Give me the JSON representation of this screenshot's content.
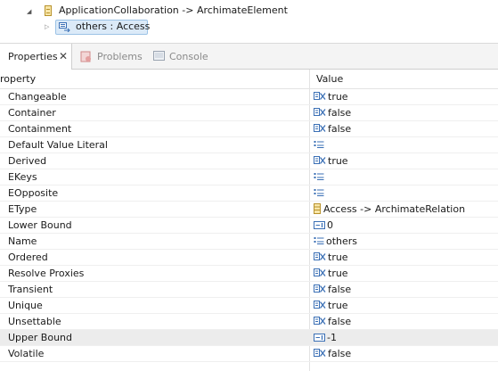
{
  "tree": {
    "parent_label": "ApplicationCollaboration -> ArchimateElement",
    "child_label": "others : Access"
  },
  "tabs": [
    {
      "label": "Properties",
      "icon": "properties-icon",
      "active": true
    },
    {
      "label": "Problems",
      "icon": "problems-icon",
      "active": false
    },
    {
      "label": "Console",
      "icon": "console-icon",
      "active": false
    }
  ],
  "table": {
    "headers": {
      "property": "roperty",
      "value": "Value"
    },
    "rows": [
      {
        "property": "Changeable",
        "value": "true",
        "icon": "boolean-icon"
      },
      {
        "property": "Container",
        "value": "false",
        "icon": "boolean-icon"
      },
      {
        "property": "Containment",
        "value": "false",
        "icon": "boolean-icon"
      },
      {
        "property": "Default Value Literal",
        "value": "",
        "icon": "text-icon"
      },
      {
        "property": "Derived",
        "value": "true",
        "icon": "boolean-icon"
      },
      {
        "property": "EKeys",
        "value": "",
        "icon": "text-icon"
      },
      {
        "property": "EOpposite",
        "value": "",
        "icon": "text-icon"
      },
      {
        "property": "EType",
        "value": "Access -> ArchimateRelation",
        "icon": "class-icon"
      },
      {
        "property": "Lower Bound",
        "value": "0",
        "icon": "number-icon"
      },
      {
        "property": "Name",
        "value": "others",
        "icon": "text-icon"
      },
      {
        "property": "Ordered",
        "value": "true",
        "icon": "boolean-icon"
      },
      {
        "property": "Resolve Proxies",
        "value": "true",
        "icon": "boolean-icon"
      },
      {
        "property": "Transient",
        "value": "false",
        "icon": "boolean-icon"
      },
      {
        "property": "Unique",
        "value": "true",
        "icon": "boolean-icon"
      },
      {
        "property": "Unsettable",
        "value": "false",
        "icon": "boolean-icon"
      },
      {
        "property": "Upper Bound",
        "value": "-1",
        "icon": "number-icon",
        "highlighted": true
      },
      {
        "property": "Volatile",
        "value": "false",
        "icon": "boolean-icon"
      }
    ]
  },
  "colors": {
    "selection_fill": "#dbeaf8",
    "selection_border": "#9cc3e6",
    "icon_blue": "#3a6fb5",
    "class_icon": "#f8e6a8"
  }
}
